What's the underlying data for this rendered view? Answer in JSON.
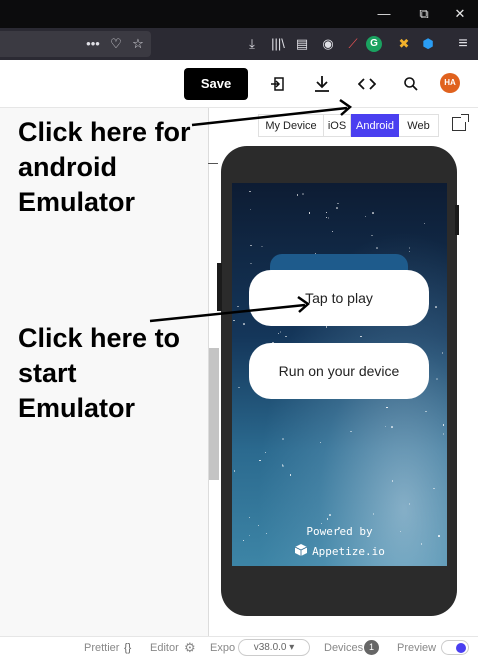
{
  "window": {
    "minimize": "—",
    "restore": "⧉",
    "close": "✕"
  },
  "browser_toolbar": {
    "more": "•••",
    "pocket": "♡",
    "star": "☆",
    "download": "⤓",
    "library": "|||\\",
    "sidebar": "▤",
    "account": "◉",
    "ext1": "⟋",
    "ext2": "G",
    "ext3": "✖",
    "ext4": "⬢",
    "menu": "≡"
  },
  "header": {
    "save_label": "Save",
    "avatar_initials": "HA"
  },
  "preview_tabs": [
    {
      "label": "My Device",
      "active": false
    },
    {
      "label": "iOS",
      "active": false
    },
    {
      "label": "Android",
      "active": true
    },
    {
      "label": "Web",
      "active": false
    }
  ],
  "emulator": {
    "tap_to_play": "Tap to play",
    "run_on_device": "Run on your device",
    "powered_by": "Powered by",
    "appetize": "Appetize.io"
  },
  "annotations": {
    "android_line1": "Click here for",
    "android_line2": "android",
    "android_line3": "Emulator",
    "start_line1": "Click here to",
    "start_line2": "start",
    "start_line3": "Emulator"
  },
  "footer": {
    "prettier": "Prettier",
    "prettier_icon": "{}",
    "editor": "Editor",
    "expo": "Expo",
    "version": "v38.0.0",
    "devices": "Devices",
    "devices_count": "1",
    "preview": "Preview"
  },
  "colors": {
    "accent": "#4a3ff0",
    "avatar": "#e0621e"
  }
}
